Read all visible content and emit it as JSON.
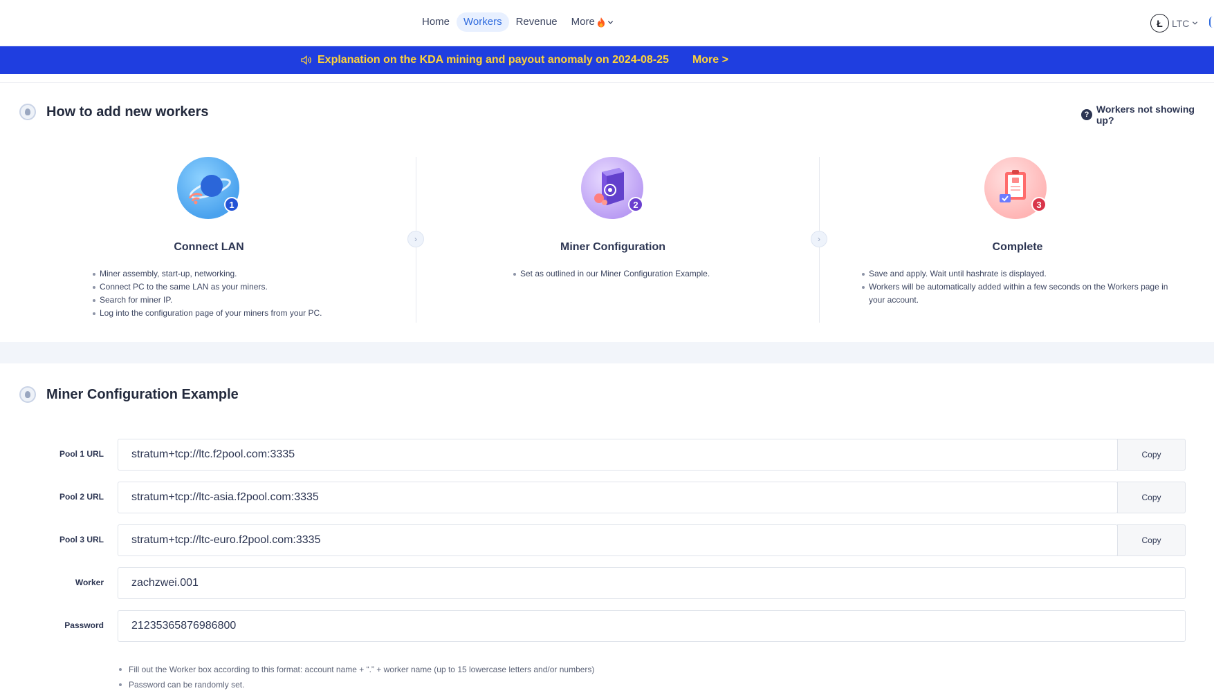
{
  "nav": {
    "items": [
      {
        "label": "Home",
        "active": false
      },
      {
        "label": "Workers",
        "active": true
      },
      {
        "label": "Revenue",
        "active": false
      }
    ],
    "more_label": "More",
    "coin": {
      "symbol": "Ł",
      "label": "LTC"
    }
  },
  "banner": {
    "text": "Explanation on the KDA mining and payout anomaly on 2024-08-25",
    "more": "More >",
    "color": "#1f3ee0",
    "text_color": "#ffd338"
  },
  "how_to": {
    "title": "How to add new workers",
    "help": "Workers not showing up?",
    "steps": [
      {
        "number": "1",
        "title": "Connect LAN",
        "icon": "planet-wifi-icon",
        "badge_color": "#2453d6",
        "items": [
          "Miner assembly, start-up, networking.",
          "Connect PC to the same LAN as your miners.",
          "Search for miner IP.",
          "Log into the configuration page of your miners from your PC."
        ]
      },
      {
        "number": "2",
        "title": "Miner Configuration",
        "icon": "miner-settings-icon",
        "badge_color": "#6a3fcf",
        "items": [
          "Set as outlined in our Miner Configuration Example."
        ]
      },
      {
        "number": "3",
        "title": "Complete",
        "icon": "clipboard-check-icon",
        "badge_color": "#d9354a",
        "items": [
          "Save and apply. Wait until hashrate is displayed.",
          "Workers will be automatically added within a few seconds on the Workers page in your account."
        ]
      }
    ]
  },
  "config": {
    "title": "Miner Configuration Example",
    "copy_label": "Copy",
    "fields": [
      {
        "label": "Pool 1 URL",
        "value": "stratum+tcp://ltc.f2pool.com:3335"
      },
      {
        "label": "Pool 2 URL",
        "value": "stratum+tcp://ltc-asia.f2pool.com:3335"
      },
      {
        "label": "Pool 3 URL",
        "value": "stratum+tcp://ltc-euro.f2pool.com:3335"
      },
      {
        "label": "Worker",
        "value": "zachzwei.001"
      },
      {
        "label": "Password",
        "value": "21235365876986800"
      }
    ],
    "notes": [
      "Fill out the Worker box according to this format: account name + “.” + worker name (up to 15 lowercase letters and/or numbers)",
      "Password can be randomly set."
    ]
  }
}
